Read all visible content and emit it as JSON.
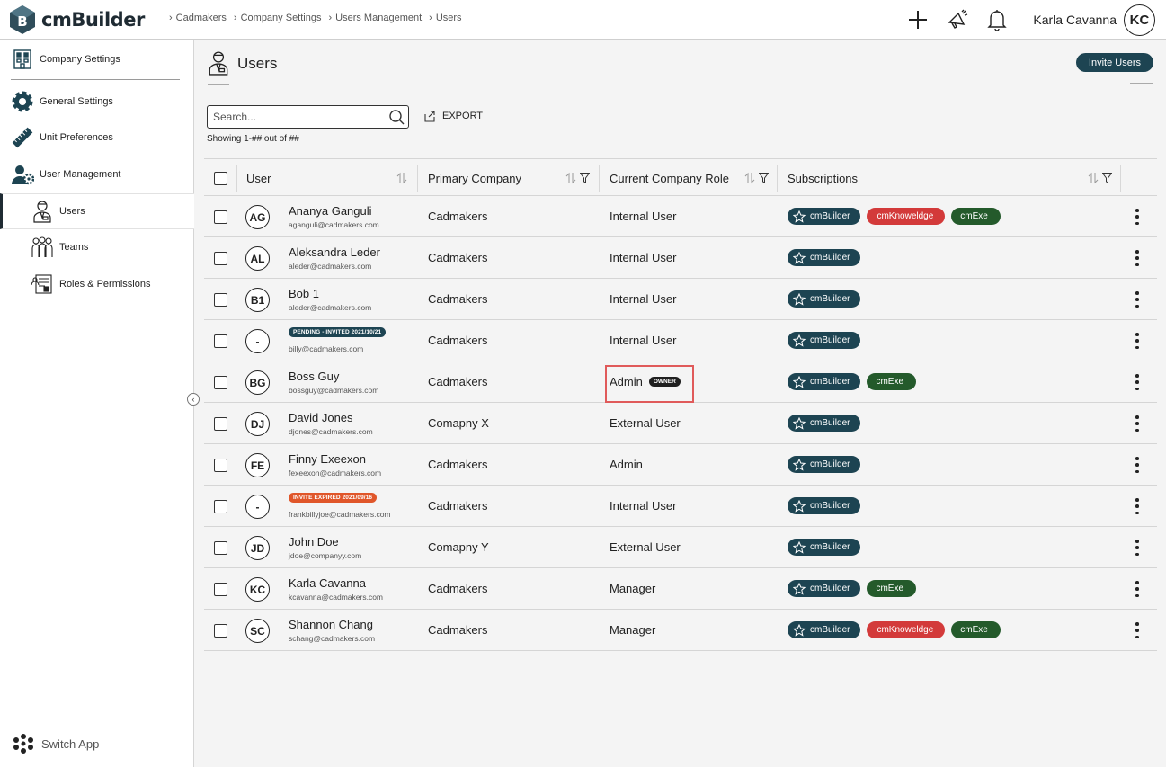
{
  "app": {
    "name": "cmBuilder"
  },
  "breadcrumb": [
    "Cadmakers",
    "Company Settings",
    "Users Management",
    "Users"
  ],
  "header": {
    "user_name": "Karla Cavanna",
    "user_initials": "KC",
    "icons": [
      "plus-icon",
      "megaphone-icon",
      "bell-icon"
    ]
  },
  "sidebar": {
    "title": "Company Settings",
    "items": [
      {
        "label": "General Settings",
        "icon": "gear-icon"
      },
      {
        "label": "Unit Preferences",
        "icon": "ruler-icon"
      },
      {
        "label": "User Management",
        "icon": "user-gear-icon"
      },
      {
        "label": "Users",
        "icon": "user-icon",
        "active": true
      },
      {
        "label": "Teams",
        "icon": "team-icon"
      },
      {
        "label": "Roles & Permissions",
        "icon": "roles-icon"
      }
    ],
    "switch_app": "Switch App"
  },
  "page": {
    "title": "Users",
    "invite_label": "Invite Users",
    "search_placeholder": "Search...",
    "export_label": "EXPORT",
    "showing": "Showing 1-## out of ##"
  },
  "table": {
    "columns": [
      "User",
      "Primary Company",
      "Current Company Role",
      "Subscriptions"
    ],
    "rows": [
      {
        "initials": "AG",
        "name": "Ananya Ganguli",
        "email": "aganguli@cadmakers.com",
        "company": "Cadmakers",
        "role": "Internal User",
        "subs": [
          "cmBuilder",
          "cmKnoweldge",
          "cmExe"
        ]
      },
      {
        "initials": "AL",
        "name": "Aleksandra Leder",
        "email": "aleder@cadmakers.com",
        "company": "Cadmakers",
        "role": "Internal User",
        "subs": [
          "cmBuilder"
        ]
      },
      {
        "initials": "B1",
        "name": "Bob 1",
        "email": "aleder@cadmakers.com",
        "company": "Cadmakers",
        "role": "Internal User",
        "subs": [
          "cmBuilder"
        ]
      },
      {
        "initials": "-",
        "badge": "PENDING - INVITED 2021/10/21",
        "email": "billy@cadmakers.com",
        "company": "Cadmakers",
        "role": "Internal User",
        "subs": [
          "cmBuilder"
        ]
      },
      {
        "initials": "BG",
        "name": "Boss Guy",
        "email": "bossguy@cadmakers.com",
        "company": "Cadmakers",
        "role": "Admin",
        "role_badge": "OWNER",
        "subs": [
          "cmBuilder",
          "cmExe"
        ]
      },
      {
        "initials": "DJ",
        "name": "David Jones",
        "email": "djones@cadmakers.com",
        "company": "Comapny X",
        "role": "External User",
        "subs": [
          "cmBuilder"
        ]
      },
      {
        "initials": "FE",
        "name": "Finny Exeexon",
        "email": "fexeexon@cadmakers.com",
        "company": "Cadmakers",
        "role": "Admin",
        "subs": [
          "cmBuilder"
        ]
      },
      {
        "initials": "-",
        "badge": "INVITE EXPIRED 2021/09/16",
        "email": "frankbillyjoe@cadmakers.com",
        "company": "Cadmakers",
        "role": "Internal User",
        "subs": [
          "cmBuilder"
        ]
      },
      {
        "initials": "JD",
        "name": "John Doe",
        "email": "jdoe@companyy.com",
        "company": "Comapny Y",
        "role": "External User",
        "subs": [
          "cmBuilder"
        ]
      },
      {
        "initials": "KC",
        "name": "Karla Cavanna",
        "email": "kcavanna@cadmakers.com",
        "company": "Cadmakers",
        "role": "Manager",
        "subs": [
          "cmBuilder",
          "cmExe"
        ]
      },
      {
        "initials": "SC",
        "name": "Shannon Chang",
        "email": "schang@cadmakers.com",
        "company": "Cadmakers",
        "role": "Manager",
        "subs": [
          "cmBuilder",
          "cmKnoweldge",
          "cmExe"
        ]
      }
    ]
  },
  "colors": {
    "primary": "#1d4452",
    "knowledge": "#d33a3a",
    "exe": "#245a2b",
    "expired": "#e0562a",
    "highlight": "#e05a5a"
  }
}
